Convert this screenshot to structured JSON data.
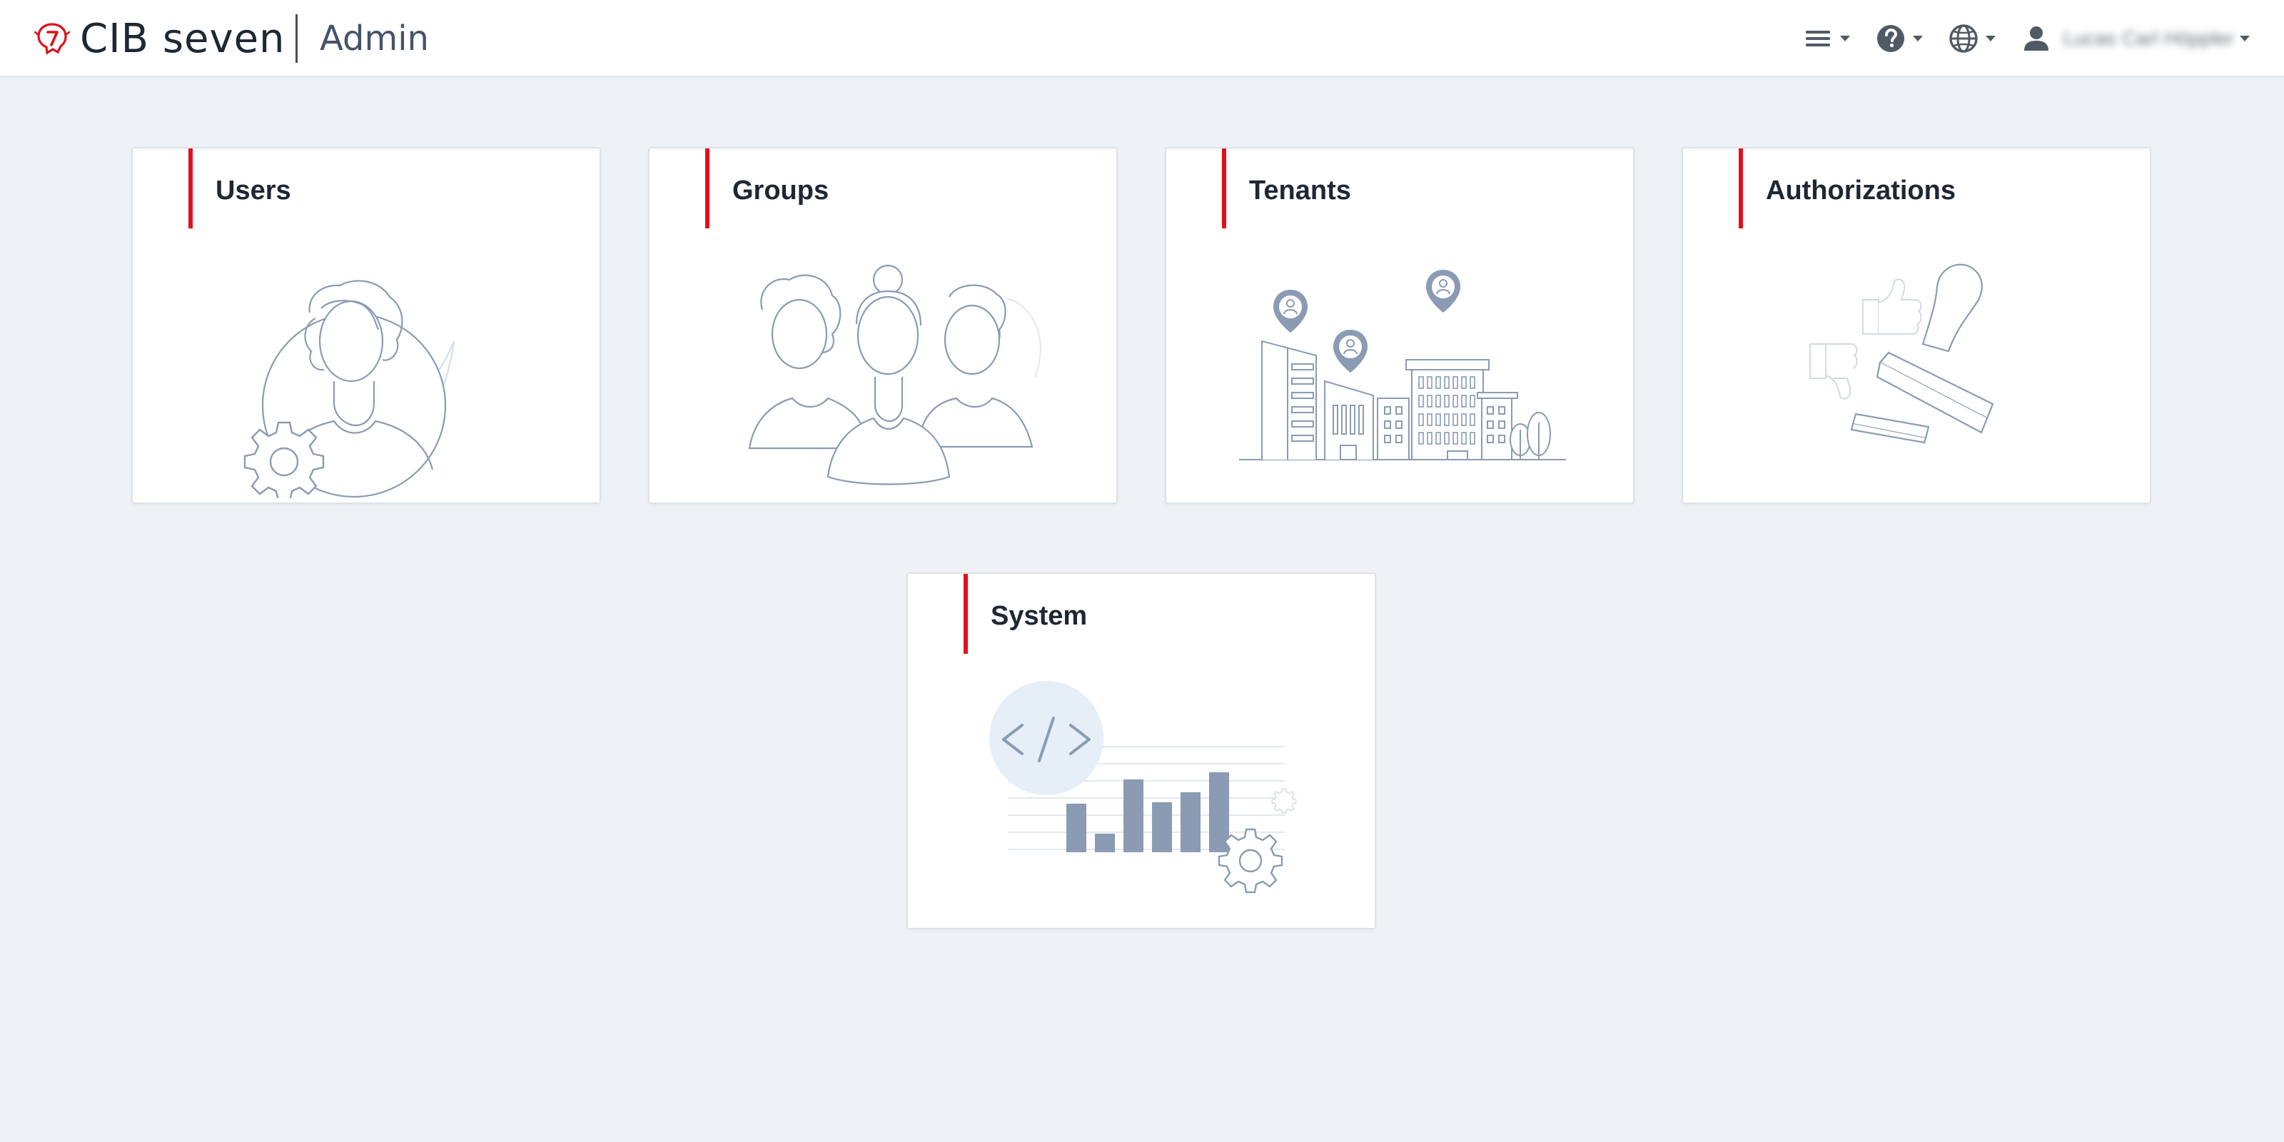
{
  "header": {
    "brand_name": "CIB seven",
    "app_name": "Admin",
    "user_name": "Lucas Carl Höppler",
    "icons": {
      "logo": "cib-seven-logo-icon",
      "menu": "hamburger-menu-icon",
      "help": "help-circle-icon",
      "language": "globe-icon",
      "user": "user-icon",
      "caret": "caret-down-icon"
    }
  },
  "cards": [
    {
      "id": "users",
      "title": "Users",
      "illustration": "user-gear-illustration"
    },
    {
      "id": "groups",
      "title": "Groups",
      "illustration": "group-people-illustration"
    },
    {
      "id": "tenants",
      "title": "Tenants",
      "illustration": "buildings-location-illustration"
    },
    {
      "id": "authorizations",
      "title": "Authorizations",
      "illustration": "stamp-thumbs-illustration"
    },
    {
      "id": "system",
      "title": "System",
      "illustration": "code-chart-gear-illustration"
    }
  ],
  "colors": {
    "accent": "#e1101a",
    "background": "#eef2f6",
    "illustration_stroke": "#8a9bb3",
    "illustration_fill": "#8a9bb3"
  }
}
